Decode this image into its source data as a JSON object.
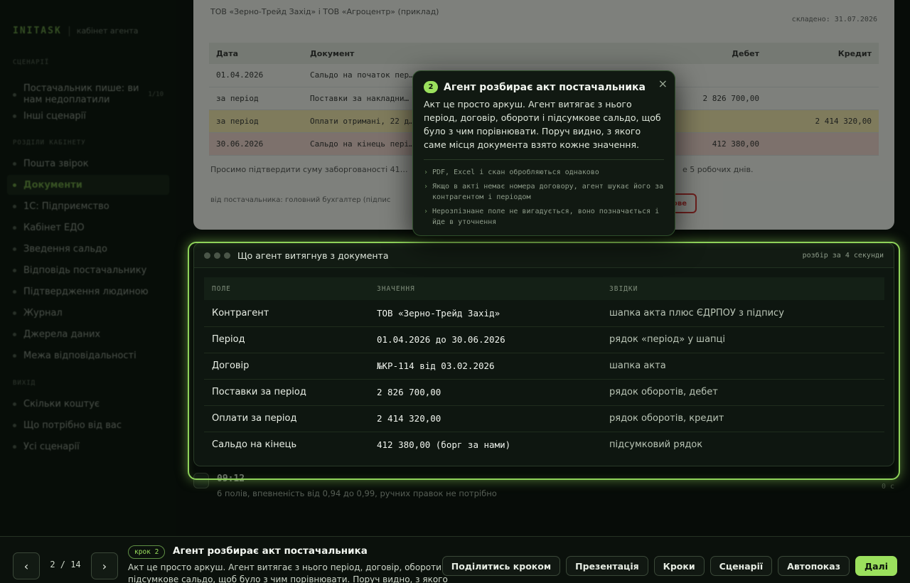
{
  "sidebar": {
    "brand": "INITASK",
    "subtitle": "кабінет агента",
    "sections": [
      {
        "label": "СЦЕНАРІЇ"
      },
      {
        "label": "РОЗДІЛИ КАБІНЕТУ"
      },
      {
        "label": "ВИХІД"
      }
    ],
    "scenario_items": [
      {
        "label": "Постачальник пише: ви нам недоплатили",
        "count": "1/10"
      },
      {
        "label": "Інші сценарії"
      }
    ],
    "cabinet_items": [
      {
        "label": "Пошта звірок"
      },
      {
        "label": "Документи",
        "active": true
      },
      {
        "label": "1С: Підприємство"
      },
      {
        "label": "Кабінет ЕДО"
      },
      {
        "label": "Зведення сальдо"
      },
      {
        "label": "Відповідь постачальнику"
      },
      {
        "label": "Підтвердження людиною"
      },
      {
        "label": "Журнал"
      },
      {
        "label": "Джерела даних"
      },
      {
        "label": "Межа відповідальності"
      }
    ],
    "exit_items": [
      {
        "label": "Скільки коштує"
      },
      {
        "label": "Що потрібно від вас"
      },
      {
        "label": "Усі сценарії"
      }
    ]
  },
  "document": {
    "header": "ТОВ «Зерно-Трейд Захід» і ТОВ «Агроцентр» (приклад)",
    "date": "складено: 31.07.2026",
    "columns": [
      "Дата",
      "Документ",
      "Дебет",
      "Кредит"
    ],
    "rows": [
      {
        "date": "01.04.2026",
        "doc": "Сальдо на початок пер…",
        "debit": "",
        "credit": "",
        "hl": ""
      },
      {
        "date": "за період",
        "doc": "Поставки за накладни…",
        "debit": "2 826 700,00",
        "credit": "",
        "hl": ""
      },
      {
        "date": "за період",
        "doc": "Оплати отримані, 22 д…",
        "debit": "",
        "credit": "2 414 320,00",
        "hl": "y"
      },
      {
        "date": "30.06.2026",
        "doc": "Сальдо на кінець пері…",
        "debit": "412 380,00",
        "credit": "",
        "hl": "r"
      }
    ],
    "note": "Просимо підтвердити суму заборгованості 41…",
    "note_tail": "е 5 робочих днів.",
    "footer": "від постачальника: головний бухгалтер (підпис",
    "stamp": "ове"
  },
  "popover": {
    "step": "2",
    "title": "Агент розбирає акт постачальника",
    "body": "Акт це просто аркуш. Агент витягає з нього період, договір, обороти і підсумкове сальдо, щоб було з чим порівнювати. Поруч видно, з якого саме місця документа взято кожне значення.",
    "close": "×",
    "bullets": [
      "PDF, Excel і скан обробляються однаково",
      "Якщо в акті немає номера договору, агент шукає його за контрагентом і періодом",
      "Нерозпізнане поле не вигадується, воно позначається і йде в уточнення"
    ]
  },
  "extraction": {
    "title": "Що агент витягнув з документа",
    "meta": "розбір за 4 секунди",
    "columns": [
      "ПОЛЕ",
      "ЗНАЧЕННЯ",
      "ЗВІДКИ"
    ],
    "rows": [
      {
        "field": "Контрагент",
        "value": "ТОВ «Зерно-Трейд Захід»",
        "source": "шапка акта плюс ЄДРПОУ з підпису"
      },
      {
        "field": "Період",
        "value": "01.04.2026 до 30.06.2026",
        "source": "рядок «період» у шапці"
      },
      {
        "field": "Договір",
        "value": "№КР-114 від 03.02.2026",
        "source": "шапка акта"
      },
      {
        "field": "Поставки за період",
        "value": "2 826 700,00",
        "source": "рядок оборотів, дебет"
      },
      {
        "field": "Оплати за період",
        "value": "2 414 320,00",
        "source": "рядок оборотів, кредит"
      },
      {
        "field": "Сальдо на кінець",
        "value": "412 380,00 (борг за нами)",
        "source": "підсумковий рядок"
      }
    ]
  },
  "timeline": {
    "time": "09:12",
    "desc": "6 полів, впевненість від 0,94 до 0,99, ручних правок не потрібно",
    "right": "0 с"
  },
  "bottombar": {
    "prev": "‹",
    "next": "›",
    "pager": "2 / 14",
    "step_badge": "крок 2",
    "step_title": "Агент розбирає акт постачальника",
    "step_desc": "Акт це просто аркуш. Агент витягає з нього період, договір, обороти і підсумкове сальдо, щоб було з чим порівнювати. Поруч видно, з якого саме місця документа взято кожне значення.",
    "actions": {
      "share": "Поділитись кроком",
      "present": "Презентація",
      "steps": "Кроки",
      "scenarios": "Сценарії",
      "autoplay": "Автопоказ",
      "next": "Далі"
    }
  },
  "colors": {
    "accent": "#9be05d",
    "background": "#070c08",
    "panel": "#0e1610"
  }
}
